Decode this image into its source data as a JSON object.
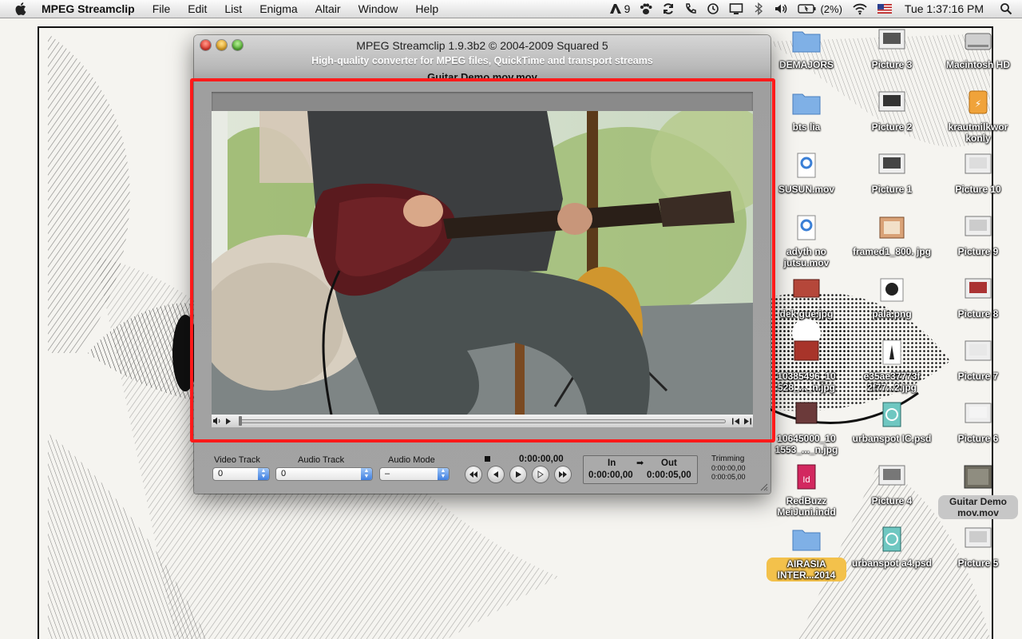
{
  "menubar": {
    "app_name": "MPEG Streamclip",
    "menus": [
      "File",
      "Edit",
      "List",
      "Enigma",
      "Altair",
      "Window",
      "Help"
    ],
    "adobe_count": "9",
    "battery": "(2%)",
    "clock": "Tue 1:37:16 PM"
  },
  "window": {
    "title": "MPEG Streamclip 1.9.3b2  ©  2004-2009 Squared 5",
    "subtitle": "High-quality converter for MPEG files, QuickTime and transport streams",
    "file_title": "Guitar Demo mov.mov",
    "controls": {
      "video_track_label": "Video Track",
      "video_track_value": "0",
      "audio_track_label": "Audio Track",
      "audio_track_value": "0",
      "audio_mode_label": "Audio Mode",
      "audio_mode_value": "–",
      "current_time": "0:00:00,00",
      "in_label": "In",
      "out_label": "Out",
      "in_time": "0:00:00,00",
      "out_time": "0:00:05,00",
      "trimming_label": "Trimming",
      "trimming_start": "0:00:00,00",
      "trimming_end": "0:00:05,00"
    }
  },
  "desktop_icons": [
    {
      "label": "DEMAJORS",
      "icon": "folder-icon"
    },
    {
      "label": "Picture 3",
      "icon": "screenshot-icon"
    },
    {
      "label": "Macintosh HD",
      "icon": "hard-drive-icon"
    },
    {
      "label": "bts lia",
      "icon": "folder-icon"
    },
    {
      "label": "Picture 2",
      "icon": "screenshot-icon"
    },
    {
      "label": "krautmilkwor konly",
      "icon": "usb-drive-icon"
    },
    {
      "label": "SUSUN.mov",
      "icon": "quicktime-movie-icon"
    },
    {
      "label": "Picture 1",
      "icon": "screenshot-icon"
    },
    {
      "label": "Picture 10",
      "icon": "screenshot-icon"
    },
    {
      "label": "adyth no jutsu.mov",
      "icon": "quicktime-movie-icon"
    },
    {
      "label": "framed1_800. jpg",
      "icon": "image-file-icon"
    },
    {
      "label": "Picture 9",
      "icon": "screenshot-icon"
    },
    {
      "label": "dek gue.jpg",
      "icon": "image-file-icon"
    },
    {
      "label": "pala.png",
      "icon": "image-file-icon"
    },
    {
      "label": "Picture 8",
      "icon": "screenshot-icon"
    },
    {
      "label": "10385496_10 528_..._n.jpg",
      "icon": "image-file-icon"
    },
    {
      "label": "e35ae37773f 2f77...2.jpg",
      "icon": "image-file-icon"
    },
    {
      "label": "Picture 7",
      "icon": "screenshot-icon"
    },
    {
      "label": "10645000_10 1553_..._n.jpg",
      "icon": "image-file-icon"
    },
    {
      "label": "urbanspot IC.psd",
      "icon": "photoshop-file-icon"
    },
    {
      "label": "Picture 6",
      "icon": "screenshot-icon"
    },
    {
      "label": "RedBuzz MeiJuni.indd",
      "icon": "indesign-file-icon"
    },
    {
      "label": "Picture 4",
      "icon": "screenshot-icon"
    },
    {
      "label": "Guitar Demo mov.mov",
      "icon": "movie-file-icon"
    },
    {
      "label": "AIRASIA INTER...2014",
      "icon": "folder-icon"
    },
    {
      "label": "urbanspot a4.psd",
      "icon": "photoshop-file-icon"
    },
    {
      "label": "Picture 5",
      "icon": "screenshot-icon"
    }
  ],
  "colors": {
    "highlight": "#ff1a1a",
    "selection_tag": "#f3c14b",
    "popup_arrows": "#3f7fe0"
  }
}
